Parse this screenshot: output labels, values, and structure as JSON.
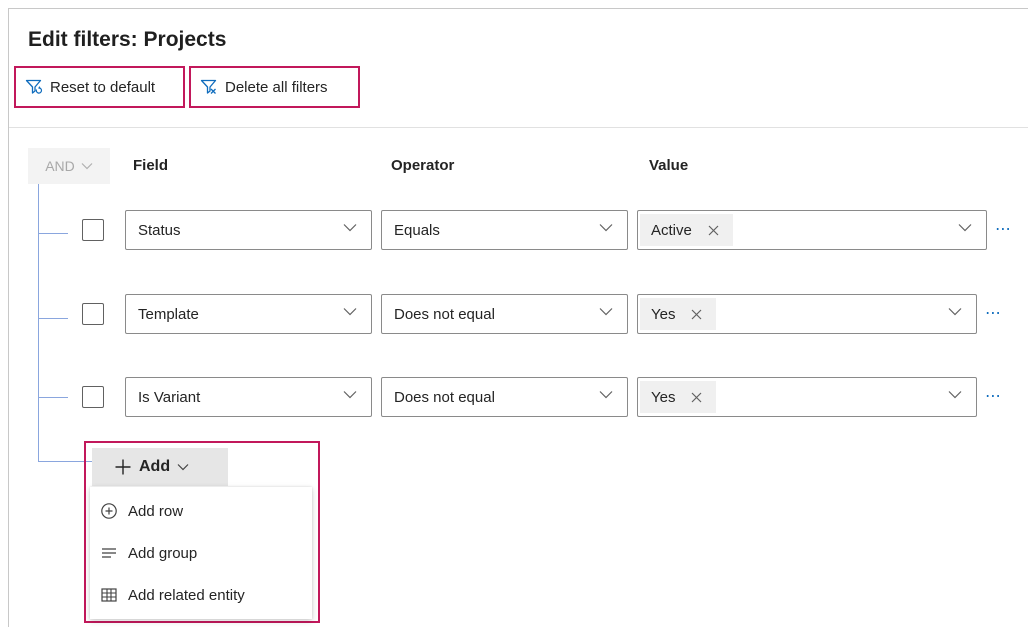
{
  "header": {
    "title": "Edit filters: Projects",
    "reset_label": "Reset to default",
    "delete_label": "Delete all filters"
  },
  "group": {
    "operator": "AND"
  },
  "columns": {
    "field": "Field",
    "operator": "Operator",
    "value": "Value"
  },
  "rows": [
    {
      "field": "Status",
      "operator": "Equals",
      "value": "Active"
    },
    {
      "field": "Template",
      "operator": "Does not equal",
      "value": "Yes"
    },
    {
      "field": "Is Variant",
      "operator": "Does not equal",
      "value": "Yes"
    }
  ],
  "add_menu": {
    "button_label": "Add",
    "items": [
      {
        "label": "Add row",
        "icon": "add-circle-icon"
      },
      {
        "label": "Add group",
        "icon": "text-lines-icon"
      },
      {
        "label": "Add related entity",
        "icon": "table-icon"
      }
    ]
  },
  "colors": {
    "highlight": "#c2185b",
    "accent": "#0f6cbd",
    "tree_line": "#8aa6de"
  }
}
